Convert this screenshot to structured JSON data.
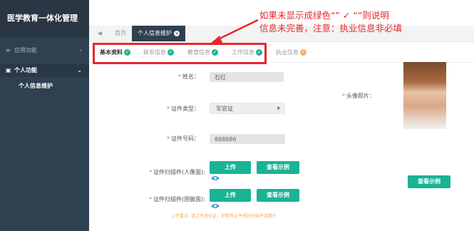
{
  "app": {
    "title": "医学教育一体化管理"
  },
  "sidebar": {
    "items": [
      {
        "label": "应用功能",
        "icon": "menu-icon",
        "arrow": "‹"
      },
      {
        "label": "个人功能",
        "icon": "user-card-icon",
        "arrow": "⌄"
      },
      {
        "label": "个人信息维护"
      }
    ]
  },
  "tabs": {
    "back": "◀",
    "home": "首页",
    "active": "个人信息维护",
    "close": "×"
  },
  "steps": [
    {
      "label": "基本资料",
      "status": "done"
    },
    {
      "label": "联系信息",
      "status": "done"
    },
    {
      "label": "教育信息",
      "status": "done"
    },
    {
      "label": "工作信息",
      "status": "done"
    },
    {
      "label": "执业信息",
      "status": "edit"
    }
  ],
  "form": {
    "name_label": "姓名：",
    "name_value": "石红",
    "id_type_label": "证件类型：",
    "id_type_value": "军官证",
    "id_number_label": "证件号码：",
    "id_number_value": "868686",
    "scan_front_label": "证件扫描件(人像面):",
    "scan_back_label": "证件扫描件(国徽面):",
    "upload_label": "上传",
    "example_label": "查看示例",
    "photo_label": "头像照片：",
    "photo_example_label": "查看示例",
    "upload_hint": "上传要求: 请上传身份证、护照等证件照的扫描件或照片",
    "required_mark": "*"
  },
  "annotation": {
    "line1": "如果未显示成绿色“” ✓ “”则说明",
    "line2": "信息未完善，注意：执业信息非必填"
  },
  "colors": {
    "sidebar": "#2f4050",
    "primary": "#1ab394",
    "warning": "#f8ac59",
    "annotation_red": "#e8262a"
  }
}
